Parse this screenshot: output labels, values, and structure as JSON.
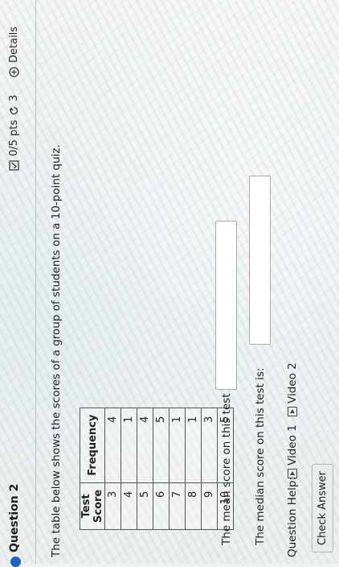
{
  "question": {
    "title": "Question 2",
    "points": "0/5 pts",
    "attempts": "3",
    "details_label": "Details",
    "prompt": "The table below shows the scores of a group of students on a 10-point quiz."
  },
  "table": {
    "headers": [
      "Test Score",
      "Frequency"
    ],
    "rows": [
      [
        "3",
        "4"
      ],
      [
        "4",
        "1"
      ],
      [
        "5",
        "4"
      ],
      [
        "6",
        "5"
      ],
      [
        "7",
        "1"
      ],
      [
        "8",
        "1"
      ],
      [
        "9",
        "3"
      ],
      [
        "10",
        "5"
      ]
    ]
  },
  "answers": {
    "mean_label": "The mean score on this test is:",
    "mean_value": "",
    "median_label": "The median score on this test is:",
    "median_value": ""
  },
  "help": {
    "label": "Question Help:",
    "video1": "Video 1",
    "video2": "Video 2"
  },
  "check_button": "Check Answer",
  "colors": {
    "accent": "#1b63c6"
  },
  "icons": [
    "question-status-dot",
    "score-box-icon",
    "retry-icon",
    "details-icon",
    "video-play-icon"
  ]
}
